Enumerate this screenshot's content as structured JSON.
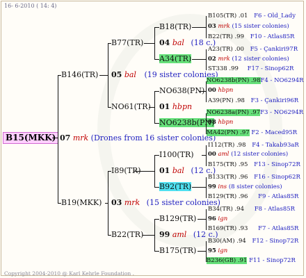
{
  "header": {
    "date": "16- 6-2010 ( 14: 4)"
  },
  "footer": {
    "copyright": "Copyright 2004-2010 @ Karl Kehrle Foundation ."
  },
  "root": {
    "label": "B15(MKK)"
  },
  "gen1": {
    "year": "07",
    "mark": "mrk",
    "note": "(Drones from 16 sister colonies)",
    "dam": "B146(TR)",
    "sire": "B19(MKK)"
  },
  "b146": {
    "year": "05",
    "mark": "bal",
    "note": "(19 sister colonies)",
    "dam": "B77(TR)",
    "sire": "NO61(TR)"
  },
  "b19": {
    "year": "03",
    "mark": "mrk",
    "note": "(15 sister colonies)",
    "dam": "I89(TR)",
    "sire": "B22(TR)"
  },
  "b77": {
    "year": "04",
    "mark": "bal",
    "note": "(18 c.)",
    "dam": "B18(TR)",
    "sire": "A34(TR)"
  },
  "no61": {
    "year": "01",
    "mark": "hbpn",
    "dam": "NO638(PN)",
    "sire": "NO6238b(PN)"
  },
  "i89": {
    "year": "01",
    "mark": "bal",
    "note": "(12 c.)",
    "dam": "I100(TR)",
    "sire": "B92(TR)"
  },
  "b22": {
    "year": "99",
    "mark": "aml",
    "note": "(12 c.)",
    "dam": "B129(TR)",
    "sire": "B175(TR)"
  },
  "leaves": [
    {
      "id": "B105(TR) .01",
      "code": "F6 - Old_Lady"
    },
    {
      "num": "03",
      "mark": "mrk",
      "note": "(15 sister colonies)"
    },
    {
      "id": "B22(TR) .99",
      "code": "F10 - Atlas85R"
    },
    {
      "id": "A23(TR) .00",
      "code": "F5 - Çankiri97R"
    },
    {
      "num": "02",
      "mark": "mrk",
      "note": "(12 sister colonies)"
    },
    {
      "id": "ST338 .99",
      "code": "F17 - Sinop62R"
    },
    {
      "id": "NO6238b(PN) .98",
      "code": "F4 - NO6294R"
    },
    {
      "num": "00",
      "mark": "hbpn",
      "note": ""
    },
    {
      "id": "A39(PN) .98",
      "code": "F3 - Çankiri96R"
    },
    {
      "id": "NO6238a(PN) .97",
      "code": "F3 - NO6294R"
    },
    {
      "num": "98",
      "mark": "hbpn",
      "note": ""
    },
    {
      "id": "MA42(PN) .97",
      "code": "F2 - Maced95R"
    },
    {
      "id": "I112(TR) .98",
      "code": "F4 - Takab93aR"
    },
    {
      "num": "00",
      "mark": "aml",
      "note": "(12 sister colonies)"
    },
    {
      "id": "B175(TR) .95",
      "code": "F13 - Sinop72R"
    },
    {
      "id": "B133(TR) .96",
      "code": "F16 - Sinop62R"
    },
    {
      "num": "99",
      "mark": "ins",
      "note": "(8 sister colonies)"
    },
    {
      "id": "B129(TR) .96",
      "code": "F9 - Atlas85R"
    },
    {
      "id": "B34(TR) .94",
      "code": "F8 - Atlas85R"
    },
    {
      "num": "96",
      "mark": "ign",
      "note": ""
    },
    {
      "id": "B169(TR) .93",
      "code": "F7 - Atlas85R"
    },
    {
      "id": "B30(AM) .94",
      "code": "F12 - Sinop72R"
    },
    {
      "num": "95",
      "mark": "ign",
      "note": ""
    },
    {
      "id": "B236(GB) .91",
      "code": "F11 - Sinop72R"
    }
  ]
}
